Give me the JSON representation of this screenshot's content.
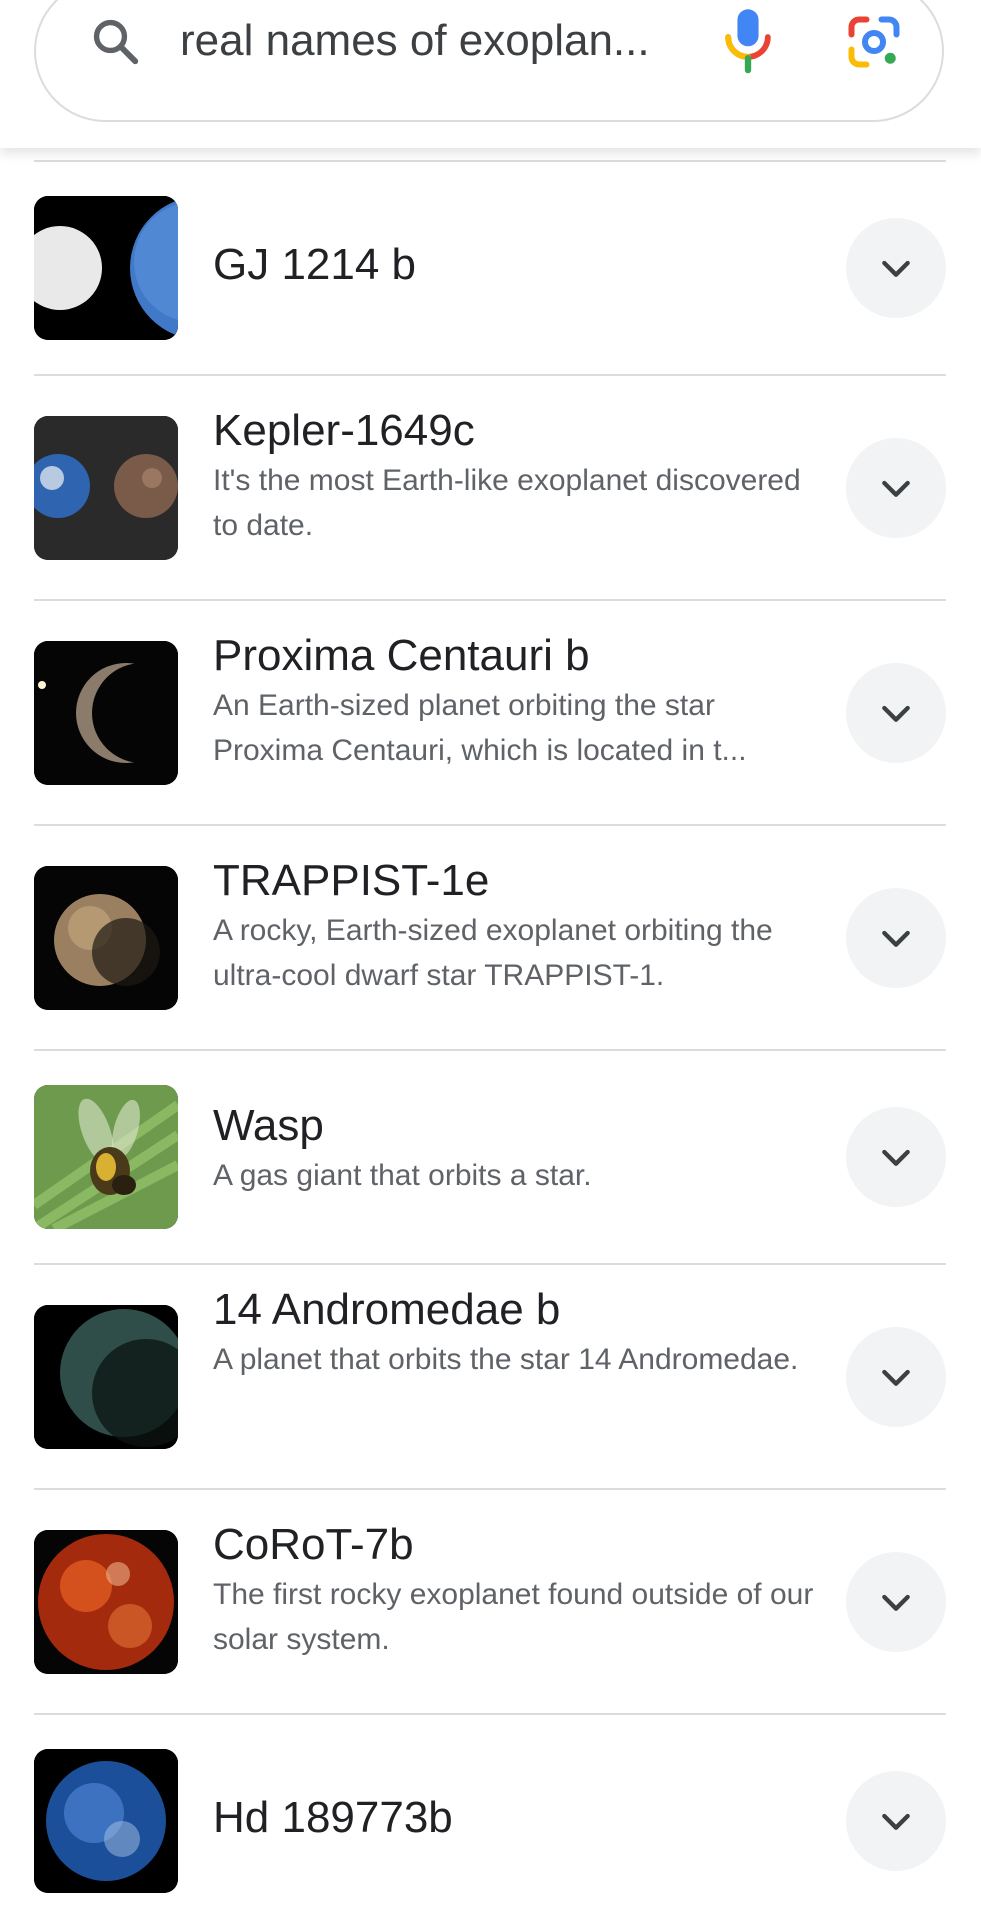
{
  "search": {
    "query": "real names of exoplan..."
  },
  "results": [
    {
      "title": "GJ 1214 b",
      "description": ""
    },
    {
      "title": "Kepler-1649c",
      "description": "It's the most Earth-like exoplanet discovered to date."
    },
    {
      "title": "Proxima Centauri b",
      "description": "An Earth-sized planet orbiting the star Proxima Centauri, which is located in t..."
    },
    {
      "title": "TRAPPIST-1e",
      "description": "A rocky, Earth-sized exoplanet orbiting the ultra-cool dwarf star TRAPPIST-1."
    },
    {
      "title": "Wasp",
      "description": "A gas giant that orbits a star."
    },
    {
      "title": "14 Andromedae b",
      "description": "A planet that orbits the star 14 Andromedae."
    },
    {
      "title": "CoRoT-7b",
      "description": "The first rocky exoplanet found outside of our solar system."
    },
    {
      "title": "Hd 189773b",
      "description": ""
    }
  ],
  "icons": {
    "search": "search-icon",
    "mic": "microphone-icon",
    "lens": "camera-lens-icon",
    "expand": "chevron-down-icon"
  },
  "colors": {
    "google_blue": "#4285F4",
    "google_red": "#EA4335",
    "google_yellow": "#FBBC04",
    "google_green": "#34A853",
    "title_text": "#202124",
    "desc_text": "#5f6368",
    "divider": "#dadce0",
    "chevron_bg": "#f1f3f4"
  }
}
